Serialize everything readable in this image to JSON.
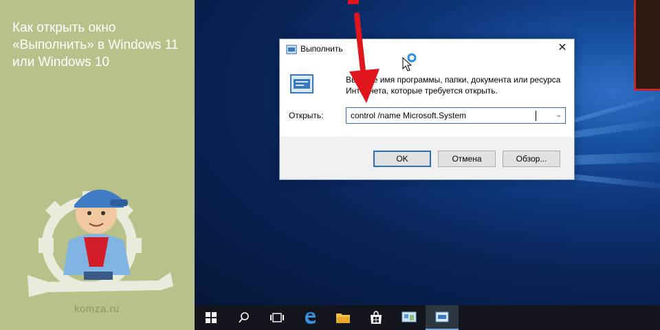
{
  "article": {
    "title": "Как открыть окно «Выполнить» в Windows 11 или Windows 10",
    "brand": "komza.ru"
  },
  "dialog": {
    "title": "Выполнить",
    "close_glyph": "✕",
    "description": "Введите имя программы, папки, документа или ресурса Интернета, которые требуется открыть.",
    "open_label": "Открыть:",
    "input_value": "control /name Microsoft.System",
    "buttons": {
      "ok": "OK",
      "cancel": "Отмена",
      "browse": "Обзор..."
    }
  },
  "taskbar": {
    "items": [
      "windows-start-icon",
      "search-icon",
      "task-view-icon",
      "edge-icon",
      "file-explorer-icon",
      "store-icon",
      "control-panel-icon",
      "run-icon"
    ]
  },
  "colors": {
    "left_panel": "#b8c18a",
    "arrow": "#e0161c",
    "taskbar": "#12161c",
    "accent": "#2a6cc9"
  }
}
